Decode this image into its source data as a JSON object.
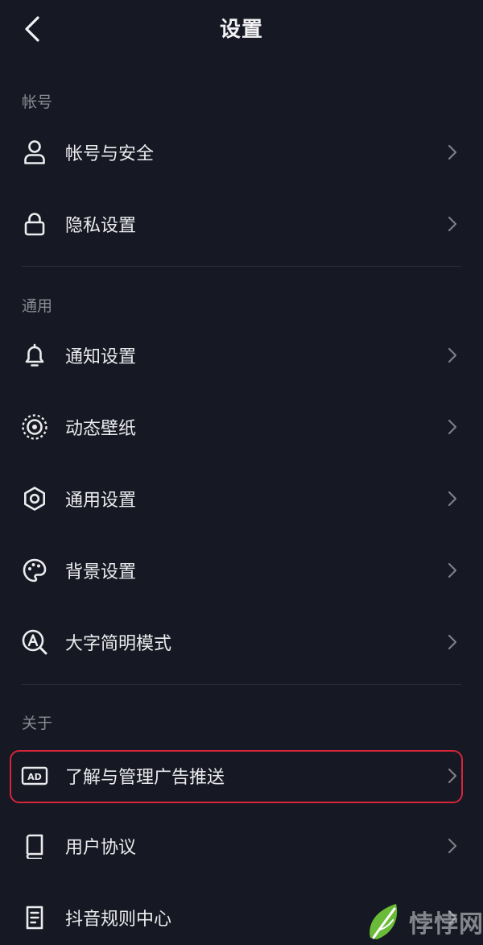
{
  "header": {
    "title": "设置"
  },
  "sections": {
    "account": {
      "title": "帐号",
      "items": [
        {
          "label": "帐号与安全",
          "icon": "user-icon"
        },
        {
          "label": "隐私设置",
          "icon": "lock-icon"
        }
      ]
    },
    "general": {
      "title": "通用",
      "items": [
        {
          "label": "通知设置",
          "icon": "bell-icon"
        },
        {
          "label": "动态壁纸",
          "icon": "live-wallpaper-icon"
        },
        {
          "label": "通用设置",
          "icon": "gear-icon"
        },
        {
          "label": "背景设置",
          "icon": "palette-icon"
        },
        {
          "label": "大字简明模式",
          "icon": "large-font-search-icon"
        }
      ]
    },
    "about": {
      "title": "关于",
      "items": [
        {
          "label": "了解与管理广告推送",
          "icon": "ad-icon"
        },
        {
          "label": "用户协议",
          "icon": "book-icon"
        },
        {
          "label": "抖音规则中心",
          "icon": "document-list-icon"
        }
      ]
    }
  },
  "watermark": {
    "text": "悖悖网",
    "icon": "leaf-logo-icon"
  },
  "colors": {
    "background": "#161823",
    "text": "#ececef",
    "section_title": "#8a8b93",
    "highlight": "#d6263a",
    "divider": "#2c2d37"
  }
}
